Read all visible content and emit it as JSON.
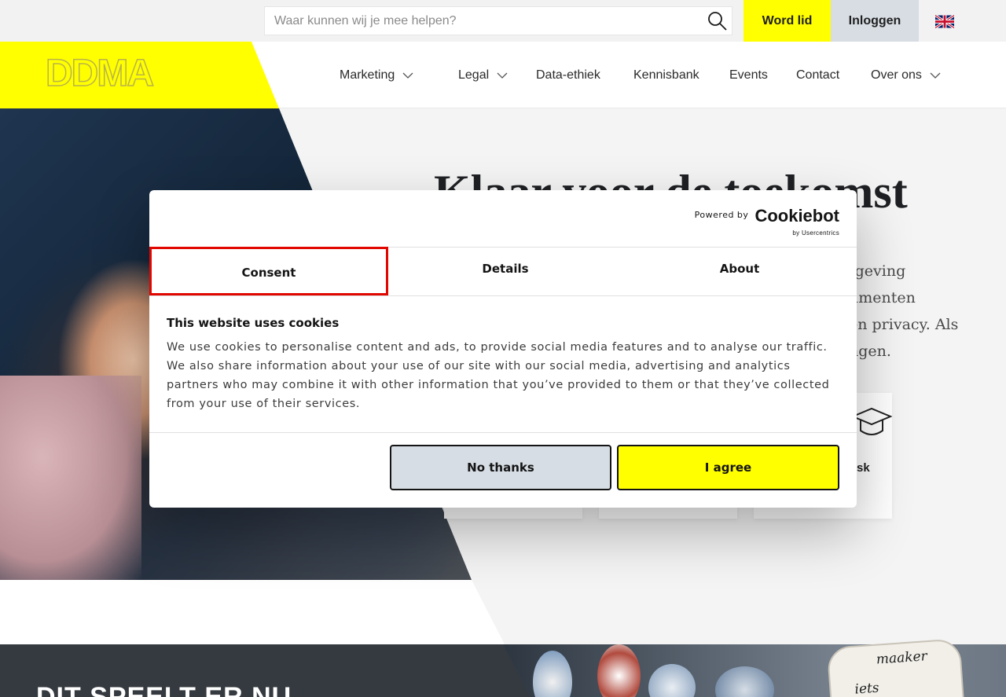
{
  "topbar": {
    "search_placeholder": "Waar kunnen wij je mee helpen?",
    "join_label": "Word lid",
    "login_label": "Inloggen"
  },
  "header": {
    "logo_text": "DDMA",
    "nav": [
      {
        "label": "Marketing",
        "has_dropdown": true
      },
      {
        "label": "Legal",
        "has_dropdown": true
      },
      {
        "label": "Data-ethiek",
        "has_dropdown": false
      },
      {
        "label": "Kennisbank",
        "has_dropdown": false
      },
      {
        "label": "Events",
        "has_dropdown": false
      },
      {
        "label": "Contact",
        "has_dropdown": false
      },
      {
        "label": "Over ons",
        "has_dropdown": true
      }
    ]
  },
  "hero": {
    "title": "Klaar voor de toekomst",
    "text_lines": [
      "tgeving",
      "umenten",
      "én privacy. Als",
      "ngen."
    ],
    "card_label": "sk"
  },
  "bottom": {
    "title": "DIT SPEELT ER NU",
    "note_line1": "maaker",
    "note_line2": "iets"
  },
  "cookie_dialog": {
    "powered_by": "Powered by",
    "brand": "Cookiebot",
    "brand_sub": "by Usercentrics",
    "tabs": [
      {
        "label": "Consent",
        "active": true
      },
      {
        "label": "Details",
        "active": false
      },
      {
        "label": "About",
        "active": false
      }
    ],
    "title": "This website uses cookies",
    "body": "We use cookies to personalise content and ads, to provide social media features and to analyse our traffic. We also share information about your use of our site with our social media, advertising and analytics partners who may combine it with other information that you’ve provided to them or that they’ve collected from your use of their services.",
    "decline_label": "No thanks",
    "accept_label": "I agree"
  },
  "colors": {
    "brand_yellow": "#ffff00",
    "focus_red": "#e10600",
    "login_grey": "#d7dde3",
    "dark_section": "#353a40"
  },
  "icons": [
    "search-icon",
    "uk-flag-icon",
    "chevron-down-icon",
    "graduation-cap-icon"
  ]
}
